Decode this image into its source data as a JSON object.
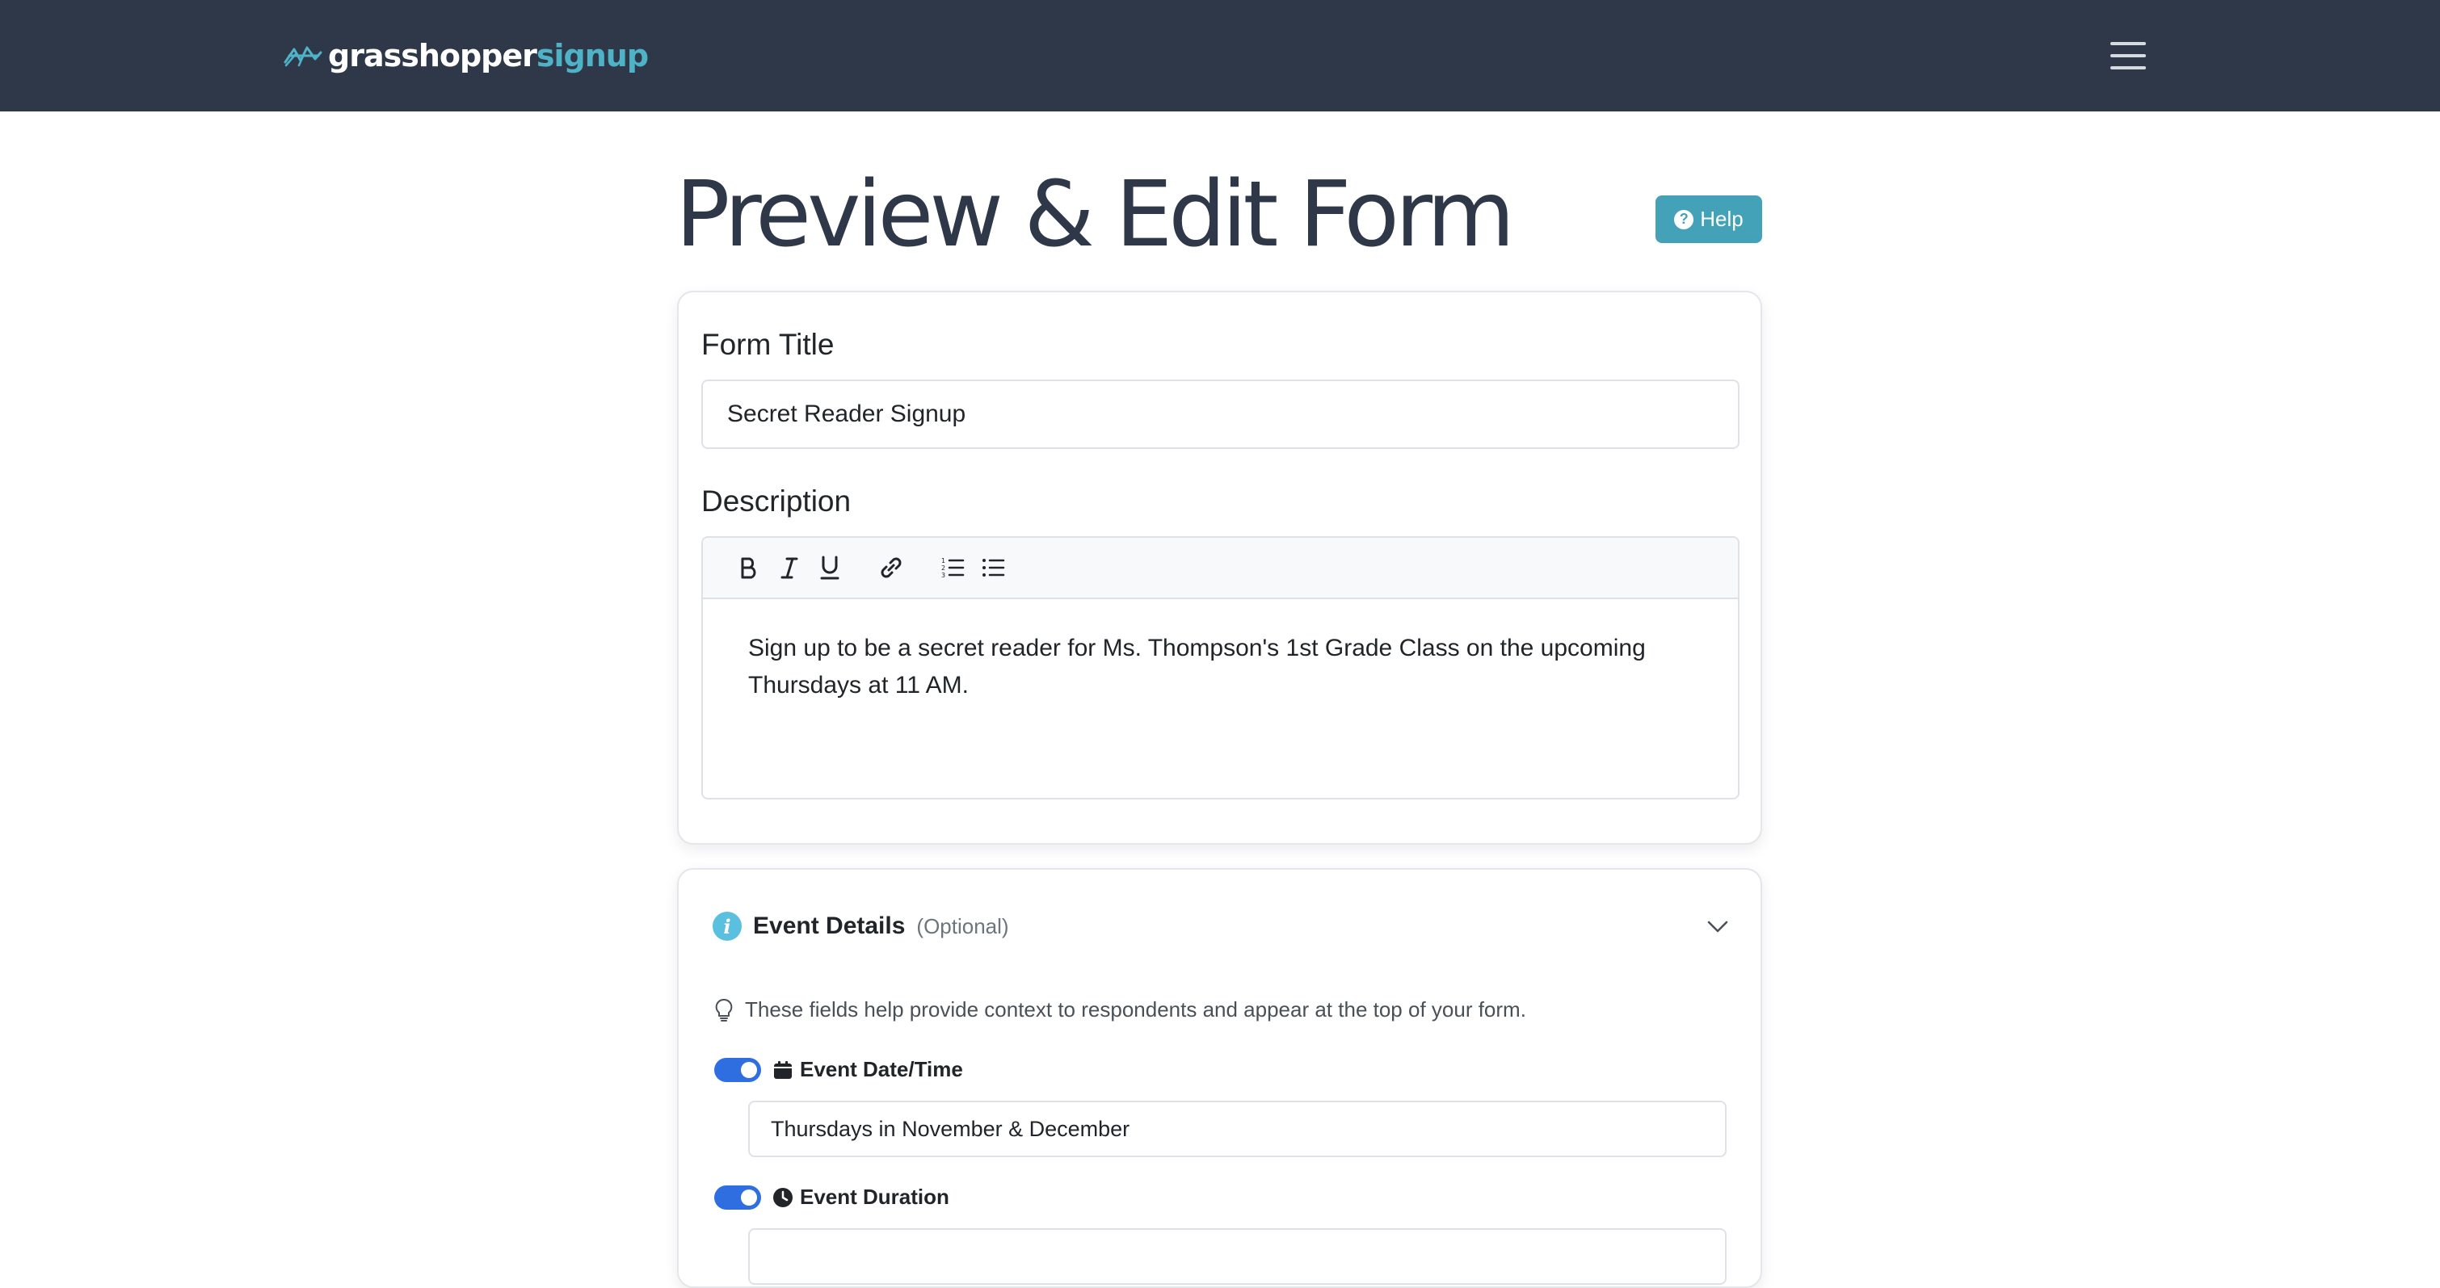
{
  "navbar": {
    "brand_main": "grasshopper",
    "brand_accent": "signup",
    "menu_icon": "hamburger-icon",
    "bg_color": "#2f3848",
    "accent_color": "#4fb3c7"
  },
  "page": {
    "title": "Preview & Edit Form",
    "help_label": "Help"
  },
  "form": {
    "title_label": "Form Title",
    "title_value": "Secret Reader Signup",
    "description_label": "Description",
    "toolbar": {
      "bold": "B",
      "italic": "I",
      "underline": "U"
    },
    "description_text": "Sign up to be a secret reader for Ms. Thompson's 1st Grade Class on the upcoming Thursdays at 11 AM."
  },
  "event_details": {
    "title": "Event Details",
    "optional": "(Optional)",
    "hint": "These fields help provide context to respondents and appear at the top of your form.",
    "fields": [
      {
        "label": "Event Date/Time",
        "value": "Thursdays in November & December",
        "enabled": true
      },
      {
        "label": "Event Duration",
        "value": "",
        "enabled": true
      }
    ]
  },
  "colors": {
    "help_button": "#44a2b8",
    "toggle_on": "#2f6ee0",
    "info_icon": "#5bbfe0"
  }
}
